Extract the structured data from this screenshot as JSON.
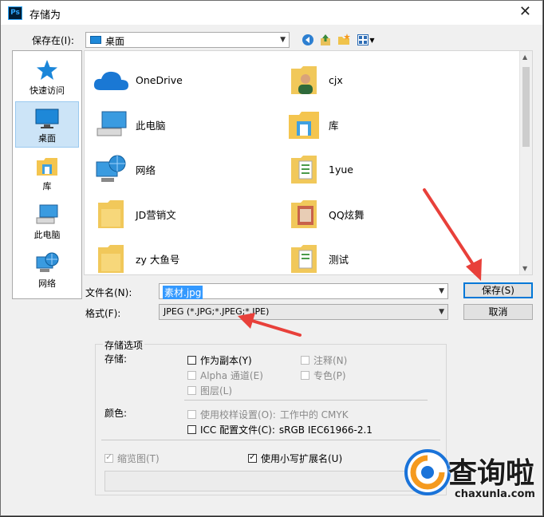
{
  "window": {
    "title": "存储为",
    "app_icon_text": "Ps"
  },
  "save_in": {
    "label": "保存在(I):",
    "value": "桌面"
  },
  "places": [
    {
      "name": "quick-access",
      "label": "快速访问"
    },
    {
      "name": "desktop",
      "label": "桌面",
      "selected": true
    },
    {
      "name": "library",
      "label": "库"
    },
    {
      "name": "this-pc",
      "label": "此电脑"
    },
    {
      "name": "network",
      "label": "网络"
    }
  ],
  "files": [
    {
      "name": "OneDrive",
      "icon": "cloud-icon"
    },
    {
      "name": "cjx",
      "icon": "user-folder-icon"
    },
    {
      "name": "此电脑",
      "icon": "computer-icon"
    },
    {
      "name": "库",
      "icon": "library-folder-icon"
    },
    {
      "name": "网络",
      "icon": "network-icon"
    },
    {
      "name": "1yue",
      "icon": "folder-icon"
    },
    {
      "name": "JD营销文",
      "icon": "folder-icon"
    },
    {
      "name": "QQ炫舞",
      "icon": "folder-icon"
    },
    {
      "name": "zy 大鱼号",
      "icon": "folder-icon"
    },
    {
      "name": "测试",
      "icon": "folder-icon"
    }
  ],
  "filename": {
    "label": "文件名(N):",
    "value": "素材.jpg"
  },
  "format": {
    "label": "格式(F):",
    "value": "JPEG (*.JPG;*.JPEG;*.JPE)"
  },
  "buttons": {
    "save": "保存(S)",
    "cancel": "取消"
  },
  "options": {
    "group_title": "存储选项",
    "storage_label": "存储:",
    "as_copy": "作为副本(Y)",
    "annotations": "注释(N)",
    "alpha": "Alpha 通道(E)",
    "spot": "专色(P)",
    "layers": "图层(L)",
    "color_label": "颜色:",
    "proof": "使用校样设置(O):",
    "proof_value": "工作中的 CMYK",
    "icc": "ICC 配置文件(C):",
    "icc_value": "sRGB IEC61966-2.1",
    "thumbnail": "缩览图(T)",
    "lowercase_ext": "使用小写扩展名(U)"
  },
  "watermark": {
    "text": "查询啦",
    "url": "chaxunla.com"
  },
  "colors": {
    "accent": "#0078d7",
    "arrow": "#e8403a",
    "selected_bg": "#cce4f7"
  }
}
